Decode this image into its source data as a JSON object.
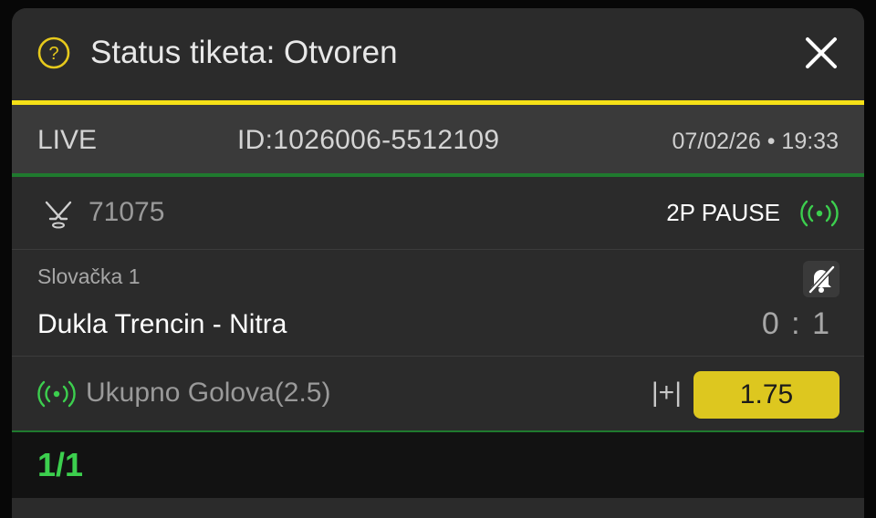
{
  "header": {
    "title": "Status tiketa: Otvoren",
    "help_icon": "help-circle-icon",
    "close_icon": "close-icon"
  },
  "ticket_info": {
    "type": "LIVE",
    "id": "ID:1026006-5512109",
    "datetime": "07/02/26 • 19:33"
  },
  "event": {
    "sport_icon": "hockey-sticks-icon",
    "code": "71075",
    "status": "2P PAUSE",
    "live_icon": "live-signal-icon",
    "league": "Slovačka 1",
    "notification_icon": "bell-off-icon",
    "teams": "Dukla Trencin - Nitra",
    "score": "0 : 1"
  },
  "bet": {
    "live_icon": "live-signal-icon",
    "market": "Ukupno Golova(2.5)",
    "selection": "|+|",
    "odds": "1.75"
  },
  "footer": {
    "count": "1/1"
  },
  "colors": {
    "accent_yellow": "#f5e017",
    "accent_green": "#3ccf4e",
    "odds_bg": "#ddc71f",
    "panel_bg": "#2b2b2b"
  }
}
